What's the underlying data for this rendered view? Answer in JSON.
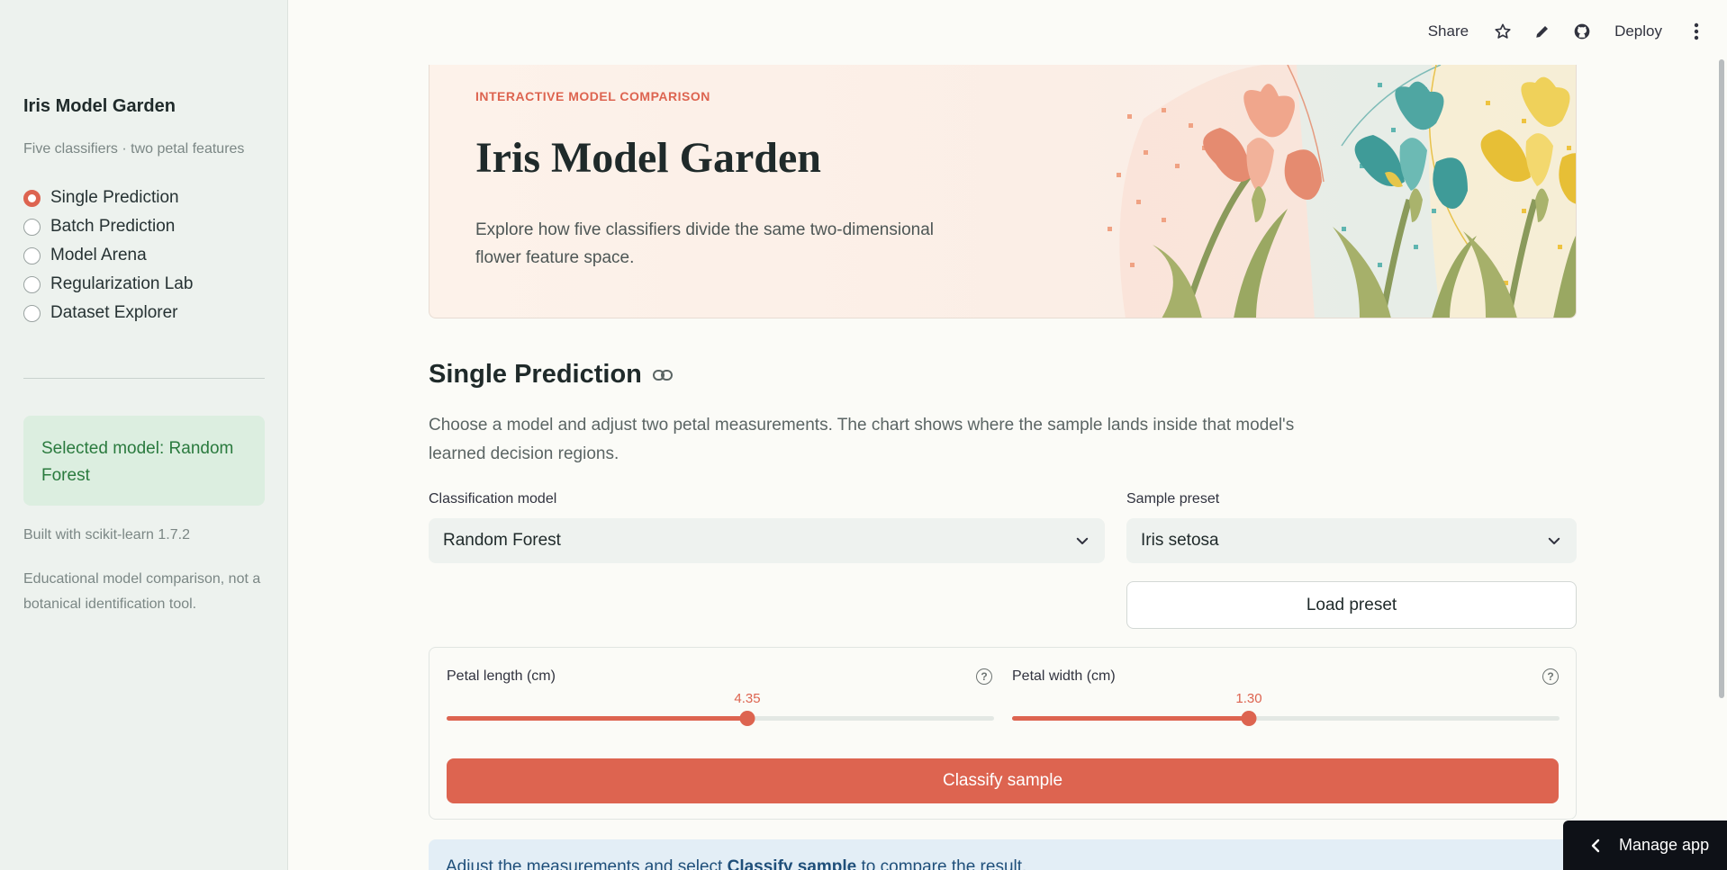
{
  "sidebar": {
    "title": "Iris Model Garden",
    "subtitle": "Five classifiers · two petal features",
    "nav": [
      {
        "label": "Single Prediction",
        "selected": true
      },
      {
        "label": "Batch Prediction",
        "selected": false
      },
      {
        "label": "Model Arena",
        "selected": false
      },
      {
        "label": "Regularization Lab",
        "selected": false
      },
      {
        "label": "Dataset Explorer",
        "selected": false
      }
    ],
    "selected_model": "Selected model: Random Forest",
    "built_with": "Built with scikit-learn 1.7.2",
    "note": "Educational model comparison, not a botanical identification tool."
  },
  "toolbar": {
    "share": "Share",
    "deploy": "Deploy",
    "icons": [
      "star-icon",
      "pencil-icon",
      "github-icon",
      "kebab-menu-icon"
    ]
  },
  "hero": {
    "eyebrow": "INTERACTIVE MODEL COMPARISON",
    "title": "Iris Model Garden",
    "description": "Explore how five classifiers divide the same two-dimensional flower feature space."
  },
  "section": {
    "title": "Single Prediction",
    "description": "Choose a model and adjust two petal measurements. The chart shows where the sample lands inside that model's learned decision regions."
  },
  "form": {
    "model_label": "Classification model",
    "model_value": "Random Forest",
    "preset_label": "Sample preset",
    "preset_value": "Iris setosa",
    "load_preset": "Load preset",
    "petal_length_label": "Petal length (cm)",
    "petal_length_value": "4.35",
    "petal_length_fraction": 0.55,
    "petal_width_label": "Petal width (cm)",
    "petal_width_value": "1.30",
    "petal_width_fraction": 0.433,
    "classify": "Classify sample"
  },
  "info": {
    "text_pre": "Adjust the measurements and select ",
    "text_bold": "Classify sample",
    "text_post": " to compare the result."
  },
  "manage_app": "Manage app",
  "colors": {
    "accent": "#dd6450",
    "sidebar_bg": "#edf2ee",
    "success_bg": "#dceee0",
    "success_text": "#2a7a3e",
    "info_bg": "#e3eef6"
  }
}
